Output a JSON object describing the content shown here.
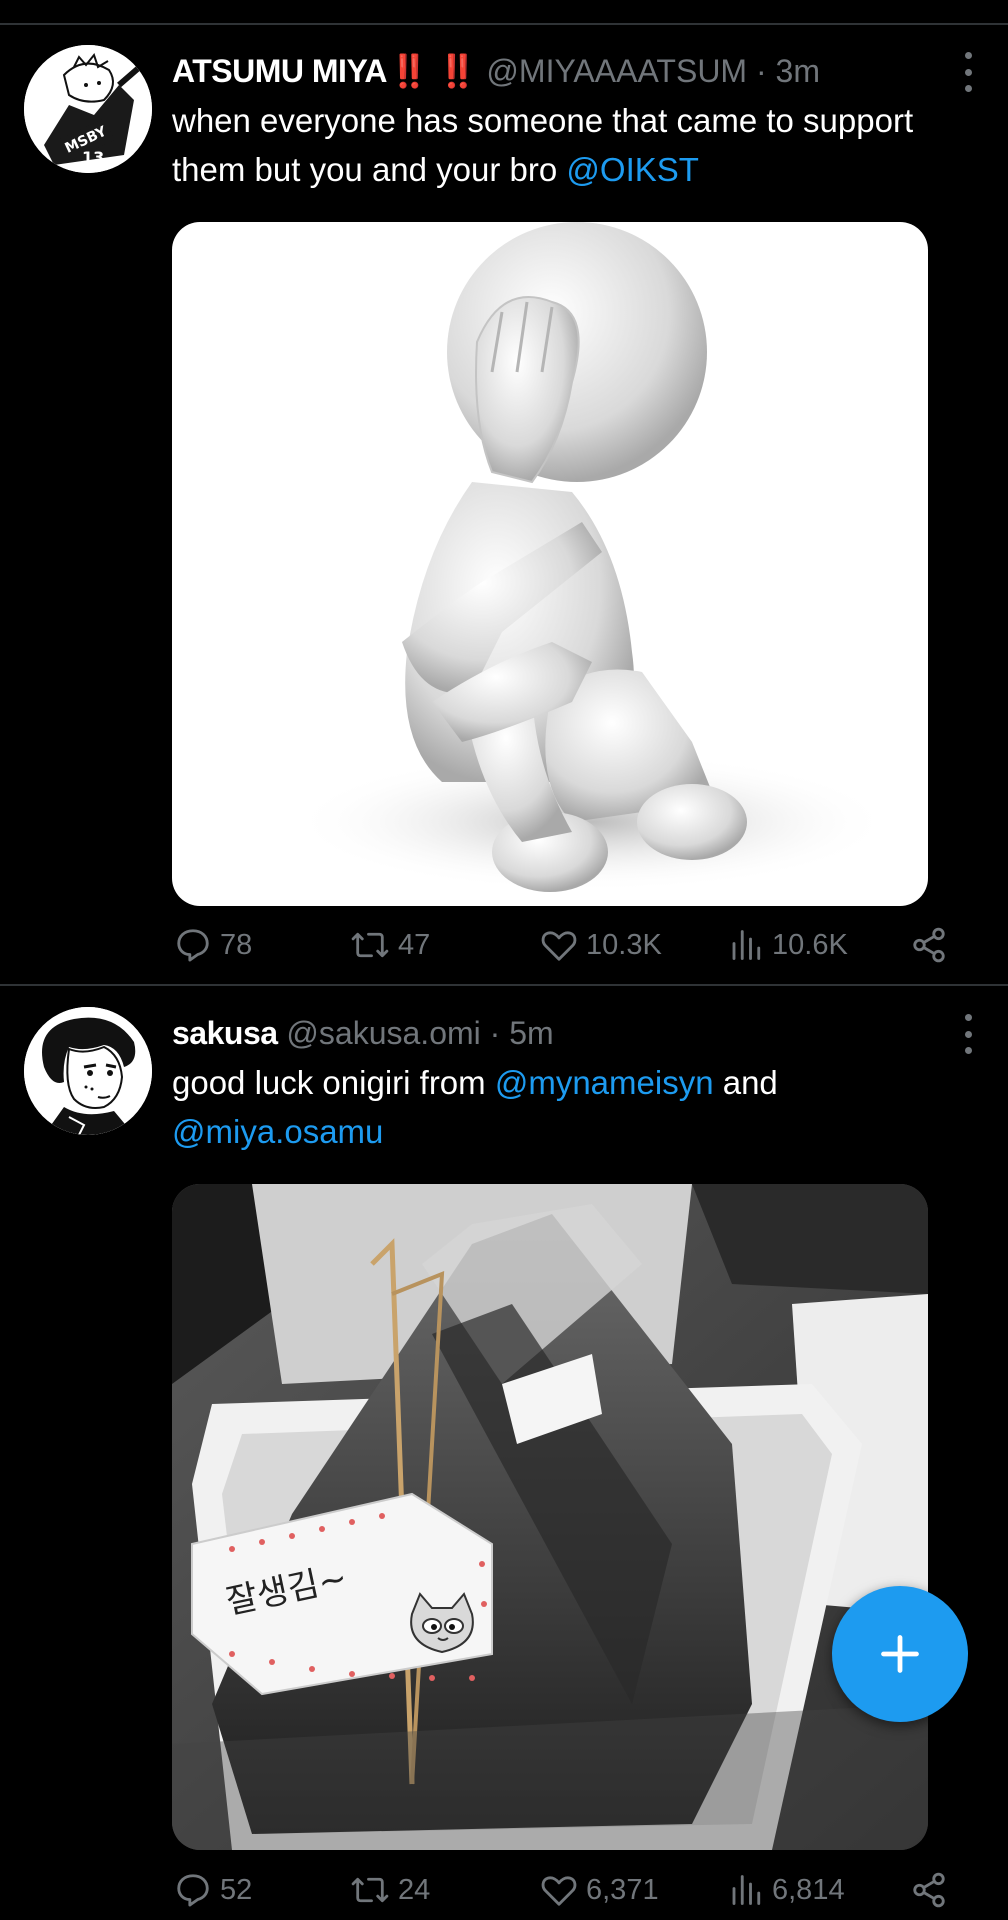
{
  "tweets": [
    {
      "display_name": "ATSUMU MIYA",
      "emoji": "‼️ ‼️",
      "handle": "@MIYAAAATSUM",
      "separator": "·",
      "time": "3m",
      "text_parts": [
        "when everyone has someone that came to support them but you and your bro ",
        "@OIKST",
        ""
      ],
      "avatar_text": "MSBY",
      "stats": {
        "replies": "78",
        "retweets": "47",
        "likes": "10.3K",
        "views": "10.6K"
      }
    },
    {
      "display_name": "sakusa",
      "emoji": "",
      "handle": "@sakusa.omi",
      "separator": "·",
      "time": "5m",
      "text_parts": [
        "good luck onigiri from ",
        "@mynameisyn",
        " and ",
        "@miya.osamu"
      ],
      "sticker_text": "잘생김~",
      "stats": {
        "replies": "52",
        "retweets": "24",
        "likes": "6,371",
        "views": "6,814"
      }
    }
  ],
  "colors": {
    "accent": "#1d9bf0",
    "muted": "#71767b",
    "background": "#000000",
    "emoji": "#e0284d"
  },
  "icons": {
    "reply": "reply-icon",
    "retweet": "retweet-icon",
    "like": "heart-icon",
    "views": "views-icon",
    "share": "share-icon",
    "compose": "plus-icon"
  }
}
